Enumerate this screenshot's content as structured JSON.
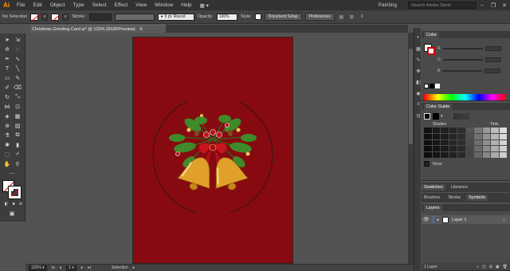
{
  "app": {
    "logo": "Ai",
    "workspace": "Painting",
    "search_placeholder": "Search Adobe Stock"
  },
  "menu": [
    "File",
    "Edit",
    "Object",
    "Type",
    "Select",
    "Effect",
    "View",
    "Window",
    "Help"
  ],
  "window_controls": [
    "–",
    "❐",
    "✕"
  ],
  "control_bar": {
    "selection_label": "No Selection",
    "stroke_label": "Stroke:",
    "stroke_style": "5 pt. Round",
    "opacity_label": "Opacity:",
    "opacity_value": "100%",
    "style_label": "Style:",
    "document_setup": "Document Setup",
    "preferences": "Preferences"
  },
  "document": {
    "tab_title": "Christmas Greeting Card.ai* @ 120% (RGB/Preview)",
    "close": "✕",
    "artboard_color": "#870a10"
  },
  "status_bar": {
    "zoom": "120%",
    "artboard_number": "1",
    "tool_status": "Selection"
  },
  "panels": {
    "color": {
      "title": "Color",
      "channels": [
        "R",
        "G",
        "B"
      ]
    },
    "color_guide": {
      "title": "Color Guide",
      "shades_label": "Shades",
      "tints_label": "Tints",
      "none_label": "None"
    },
    "swatches": {
      "tabs": [
        "Swatches",
        "Libraries"
      ]
    },
    "brushes": {
      "tabs": [
        "Brushes",
        "Stroke",
        "Symbols"
      ]
    },
    "layers": {
      "title": "Layers",
      "layer_name": "Layer 1",
      "footer": "1 Layer"
    }
  },
  "colors": {
    "accent_orange": "#ff9a00",
    "artboard": "#870a10",
    "layer_color": "#3f6fd6"
  }
}
